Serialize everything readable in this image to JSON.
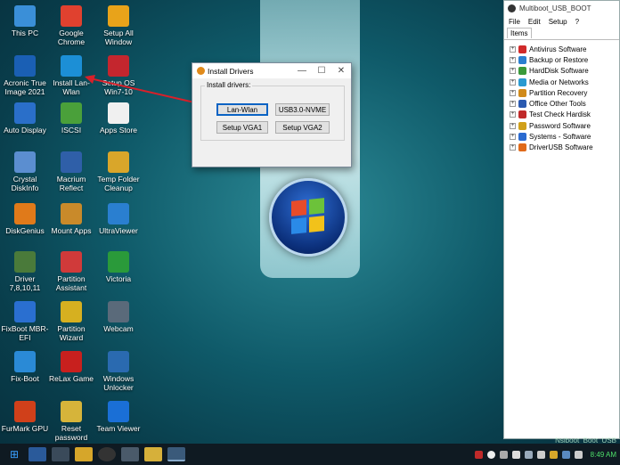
{
  "desktop": {
    "icons": [
      {
        "label": "This PC",
        "icon": "computer-icon",
        "color": "#3a8fd8"
      },
      {
        "label": "Google Chrome",
        "icon": "chrome-icon",
        "color": "#e0412f"
      },
      {
        "label": "Setup All Window",
        "icon": "setup-window-icon",
        "color": "#e8a31a"
      },
      {
        "label": "Acronic True Image 2021",
        "icon": "acronis-icon",
        "color": "#1a5fb4"
      },
      {
        "label": "Install Lan-Wlan",
        "icon": "wifi-icon",
        "color": "#1c8fd6"
      },
      {
        "label": "Setup OS Win7-10",
        "icon": "windows-setup-icon",
        "color": "#c4262e"
      },
      {
        "label": "Auto Display",
        "icon": "display-icon",
        "color": "#2a6fc9"
      },
      {
        "label": "ISCSI",
        "icon": "globe-icon",
        "color": "#4aa03a"
      },
      {
        "label": "Apps Store",
        "icon": "store-icon",
        "color": "#f0f0f0"
      },
      {
        "label": "Crystal DiskInfo",
        "icon": "disk-icon",
        "color": "#5b8ed0"
      },
      {
        "label": "Macrium Reflect",
        "icon": "macrium-icon",
        "color": "#2f5fa8"
      },
      {
        "label": "Temp Folder Cleanup",
        "icon": "broom-icon",
        "color": "#d9a62a"
      },
      {
        "label": "DiskGenius",
        "icon": "diskgenius-icon",
        "color": "#e07a1a"
      },
      {
        "label": "Mount Apps",
        "icon": "tools-icon",
        "color": "#c98a2a"
      },
      {
        "label": "UltraViewer",
        "icon": "ultraviewer-icon",
        "color": "#2a7fd0"
      },
      {
        "label": "Driver 7,8,10,11",
        "icon": "driver-icon",
        "color": "#4a7a3a"
      },
      {
        "label": "Partition Assistant",
        "icon": "partition-icon",
        "color": "#d03a3a"
      },
      {
        "label": "Victoria",
        "icon": "plus-icon",
        "color": "#2a9a3a"
      },
      {
        "label": "FixBoot MBR-EFI",
        "icon": "fixboot-icon",
        "color": "#2a6fd0"
      },
      {
        "label": "Partition Wizard",
        "icon": "wizard-icon",
        "color": "#d6b020"
      },
      {
        "label": "Webcam",
        "icon": "webcam-icon",
        "color": "#5a6a7a"
      },
      {
        "label": "Fix-Boot",
        "icon": "pie-icon",
        "color": "#2a8ad6"
      },
      {
        "label": "ReLax Game",
        "icon": "flash-icon",
        "color": "#c8201e"
      },
      {
        "label": "Windows Unlocker",
        "icon": "unlocker-icon",
        "color": "#2a6ab0"
      },
      {
        "label": "FurMark GPU",
        "icon": "furmark-icon",
        "color": "#d0401a"
      },
      {
        "label": "Reset password",
        "icon": "key-icon",
        "color": "#d6b43a"
      },
      {
        "label": "Team Viewer",
        "icon": "teamviewer-icon",
        "color": "#1a6fd6"
      }
    ]
  },
  "dialog": {
    "title": "Install Drivers",
    "group_label": "Install drivers:",
    "buttons": {
      "lan": "Lan-Wlan",
      "usb": "USB3.0-NVME",
      "vga1": "Setup VGA1",
      "vga2": "Setup VGA2"
    },
    "minimize": "—",
    "maximize": "☐",
    "close": "✕"
  },
  "multiboot": {
    "title": "Multiboot_USB_BOOT",
    "menu": [
      "File",
      "Edit",
      "Setup",
      "?"
    ],
    "tab": "Items",
    "items": [
      {
        "label": "Antivirus Software",
        "color": "#d02a2a"
      },
      {
        "label": "Backup or Restore",
        "color": "#2a7fd0"
      },
      {
        "label": "HardDisk Software",
        "color": "#3a9a3a"
      },
      {
        "label": "Media or Networks",
        "color": "#2a9ad0"
      },
      {
        "label": "Partition Recovery",
        "color": "#d08a1a"
      },
      {
        "label": "Office Other Tools",
        "color": "#2a5ab0"
      },
      {
        "label": "Test Check Hardisk",
        "color": "#c02a2a"
      },
      {
        "label": "Password Software",
        "color": "#d0a01a"
      },
      {
        "label": "Systems - Software",
        "color": "#2a6ad0"
      },
      {
        "label": "DriverUSB Software",
        "color": "#e06a1a"
      }
    ]
  },
  "taskbar": {
    "start": "⊞",
    "clock": "8:49 AM"
  },
  "watermark": "Nsiboot_Boot_USB"
}
